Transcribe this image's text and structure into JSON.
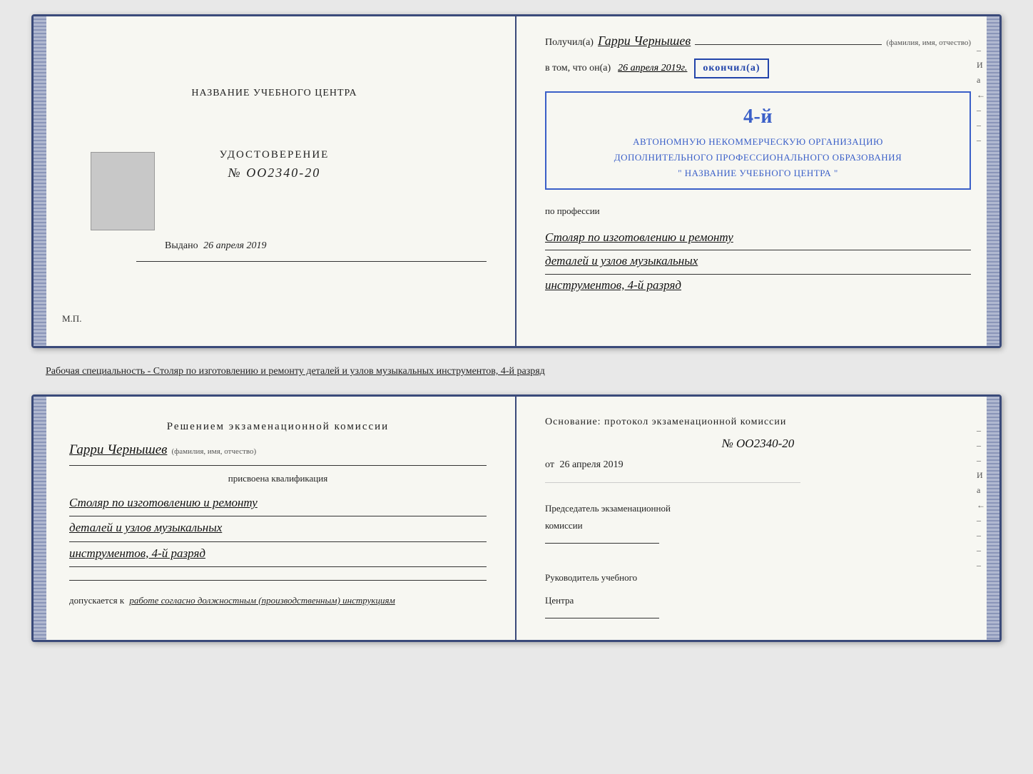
{
  "page": {
    "background": "#e8e8e8"
  },
  "top_doc": {
    "left": {
      "title": "НАЗВАНИЕ УЧЕБНОГО ЦЕНТРА",
      "udost_label": "УДОСТОВЕРЕНИЕ",
      "udost_number": "№ OO2340-20",
      "vydano_label": "Выдано",
      "vydano_date": "26 апреля 2019",
      "mp_label": "М.П."
    },
    "right": {
      "poluchil_label": "Получил(а)",
      "recipient_name": "Гарри Чернышев",
      "fio_caption": "(фамилия, имя, отчество)",
      "vtom_label": "в том, что он(а)",
      "date_value": "26 апреля 2019г.",
      "okonchil_label": "окончил(а)",
      "year_big": "4-й",
      "stamp_line1": "АВТОНОМНУЮ НЕКОММЕРЧЕСКУЮ ОРГАНИЗАЦИЮ",
      "stamp_line2": "ДОПОЛНИТЕЛЬНОГО ПРОФЕССИОНАЛЬНОГО ОБРАЗОВАНИЯ",
      "stamp_line3": "\" НАЗВАНИЕ УЧЕБНОГО ЦЕНТРА \"",
      "po_professii": "по профессии",
      "profession_line1": "Столяр по изготовлению и ремонту",
      "profession_line2": "деталей и узлов музыкальных",
      "profession_line3": "инструментов, 4-й разряд",
      "right_labels": [
        "–",
        "И",
        "а",
        "←",
        "–",
        "–",
        "–",
        "–"
      ]
    }
  },
  "specialty_label": "Рабочая специальность - Столяр по изготовлению и ремонту деталей и узлов музыкальных инструментов, 4-й разряд",
  "bottom_doc": {
    "left": {
      "resheniem_line1": "Решением  экзаменационной  комиссии",
      "applicant_name": "Гарри Чернышев",
      "fio_caption": "(фамилия, имя, отчество)",
      "prisvoena_text": "присвоена квалификация",
      "qual_line1": "Столяр по изготовлению и ремонту",
      "qual_line2": "деталей и узлов музыкальных",
      "qual_line3": "инструментов, 4-й разряд",
      "dopuskaetsya_prefix": "допускается к",
      "dopusk_value": "работе согласно должностным (производственным) инструкциям"
    },
    "right": {
      "osnovanie_text": "Основание: протокол  экзаменационной  комиссии",
      "protocol_number": "№  OO2340-20",
      "ot_label": "от",
      "ot_date": "26 апреля 2019",
      "predsedatel_line1": "Председатель экзаменационной",
      "predsedatel_line2": "комиссии",
      "rukovoditel_line1": "Руководитель учебного",
      "rukovoditel_line2": "Центра",
      "right_labels": [
        "–",
        "–",
        "–",
        "И",
        "а",
        "←",
        "–",
        "–",
        "–",
        "–"
      ]
    }
  }
}
